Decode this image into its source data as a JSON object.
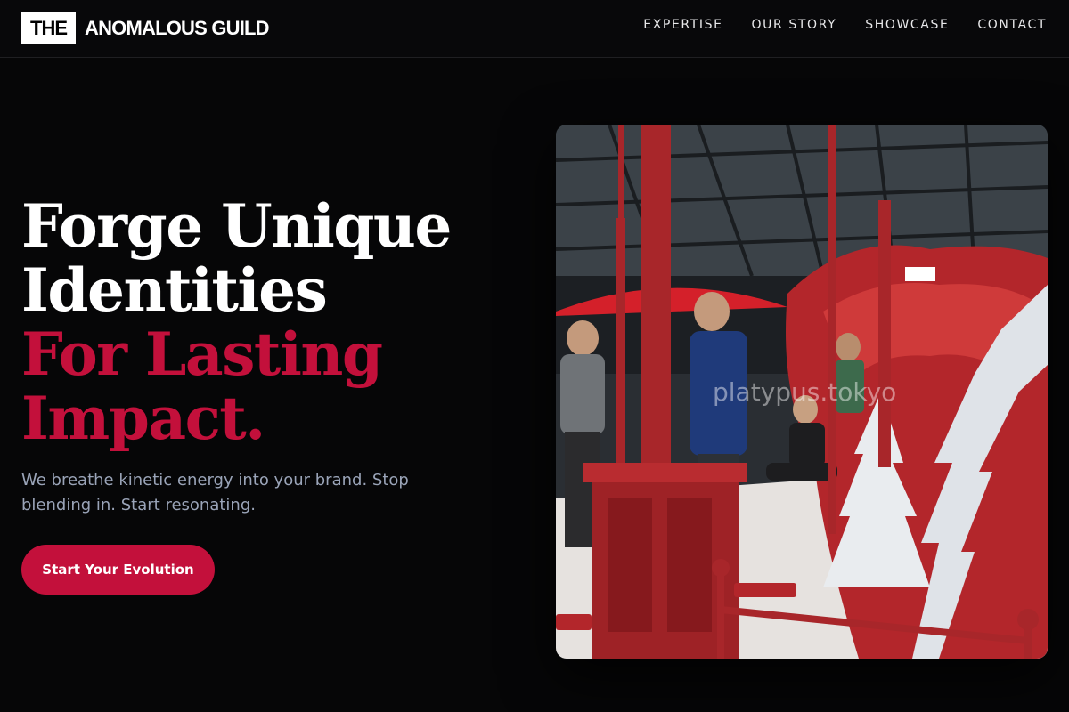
{
  "header": {
    "logo_box": "THE",
    "logo_text": "ANOMALOUS GUILD",
    "nav": [
      "EXPERTISE",
      "OUR STORY",
      "SHOWCASE",
      "CONTACT"
    ]
  },
  "hero": {
    "headline_line1": "Forge Unique",
    "headline_line2": "Identities",
    "headline_line3": "For Lasting",
    "headline_line4": "Impact.",
    "subtitle": "We breathe kinetic energy into your brand. Stop blending in. Start resonating.",
    "cta_label": "Start Your Evolution",
    "image_watermark": "platypus.tokyo"
  },
  "colors": {
    "accent": "#c3103b",
    "background": "#060607",
    "subtitle": "#9aa4b8"
  }
}
